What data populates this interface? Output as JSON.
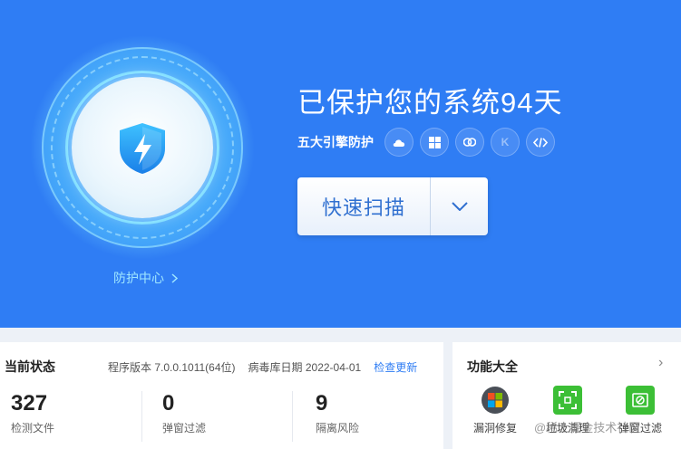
{
  "hero": {
    "title": "已保护您的系统94天",
    "engines_label": "五大引擎防护",
    "engine_icons": [
      "cloud-icon",
      "windows-icon",
      "ai-brain-icon",
      "k-icon",
      "code-icon"
    ],
    "engine_k_glyph": "K",
    "scan_button": "快速扫描",
    "center_link": "防护中心",
    "colors": {
      "background": "#2f7df4",
      "accent": "#2f6fd0"
    }
  },
  "status": {
    "title": "当前状态",
    "version": "程序版本 7.0.0.1011(64位)",
    "virus_db": "病毒库日期 2022-04-01",
    "update_link": "检查更新",
    "stats": [
      {
        "value": "327",
        "label": "检测文件"
      },
      {
        "value": "0",
        "label": "弹窗过滤"
      },
      {
        "value": "9",
        "label": "隔离风险"
      }
    ]
  },
  "features": {
    "title": "功能大全",
    "more": "›",
    "items": [
      {
        "label": "漏洞修复",
        "icon": "windows-patch-icon"
      },
      {
        "label": "垃圾清理",
        "icon": "scan-frame-icon"
      },
      {
        "label": "弹窗过滤",
        "icon": "popup-block-icon"
      }
    ]
  },
  "watermark": "@稀土掘金技术社区"
}
